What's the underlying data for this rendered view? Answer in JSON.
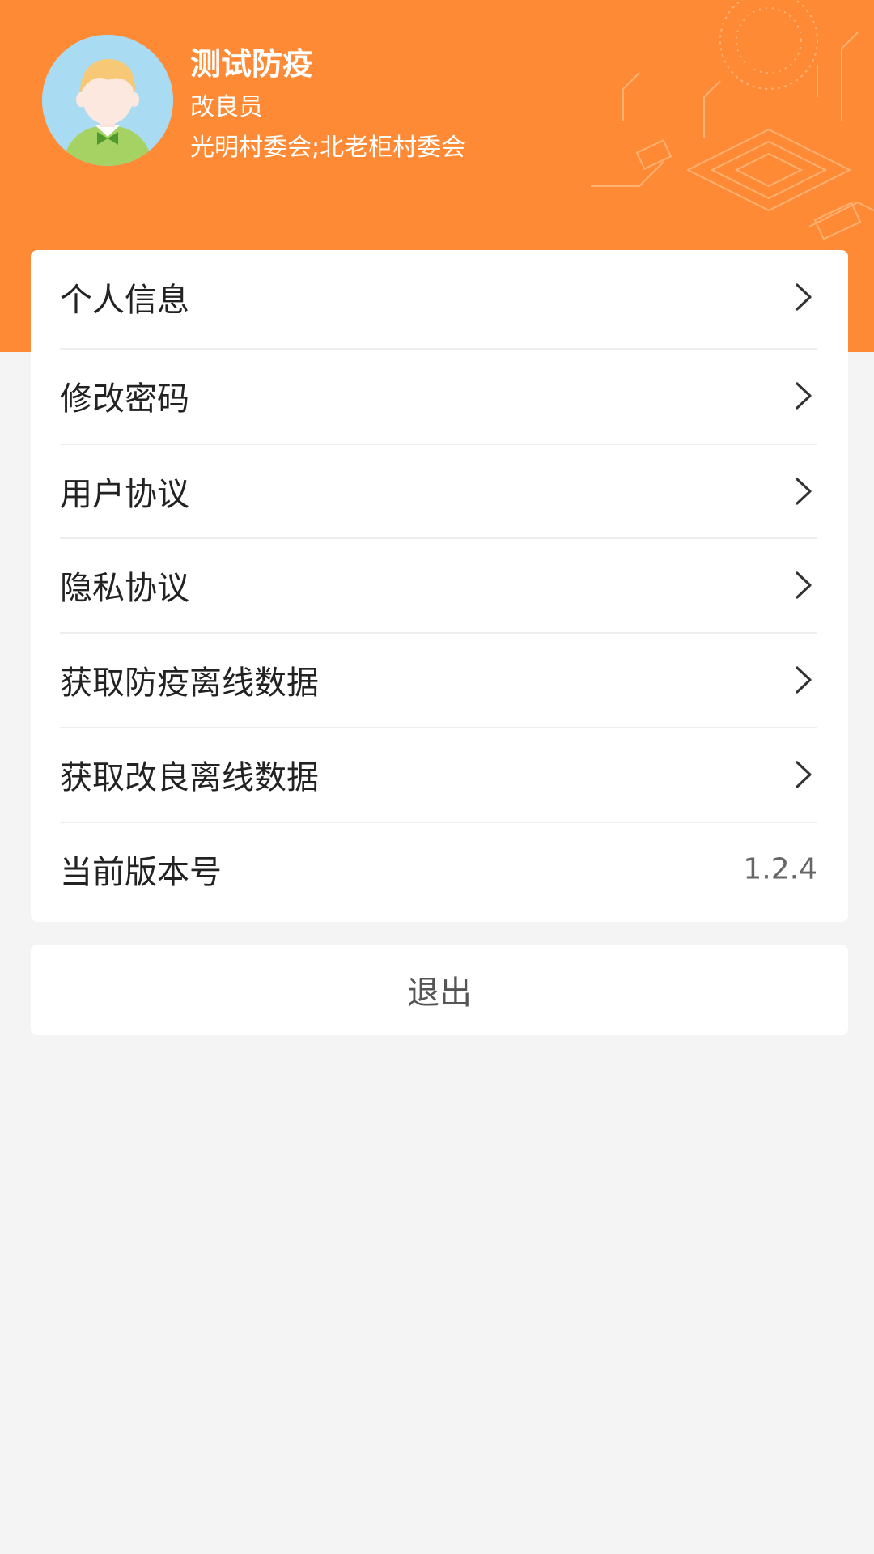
{
  "profile": {
    "name": "测试防疫",
    "role": "改良员",
    "organization": "光明村委会;北老柜村委会",
    "avatar_icon": "user-avatar-icon"
  },
  "colors": {
    "header": "#ff8a35",
    "background": "#f4f4f4"
  },
  "menu": {
    "items": [
      {
        "label": "个人信息"
      },
      {
        "label": "修改密码"
      },
      {
        "label": "用户协议"
      },
      {
        "label": "隐私协议"
      },
      {
        "label": "获取防疫离线数据"
      },
      {
        "label": "获取改良离线数据"
      }
    ],
    "version": {
      "label": "当前版本号",
      "value": "1.2.4"
    }
  },
  "logout_label": "退出"
}
